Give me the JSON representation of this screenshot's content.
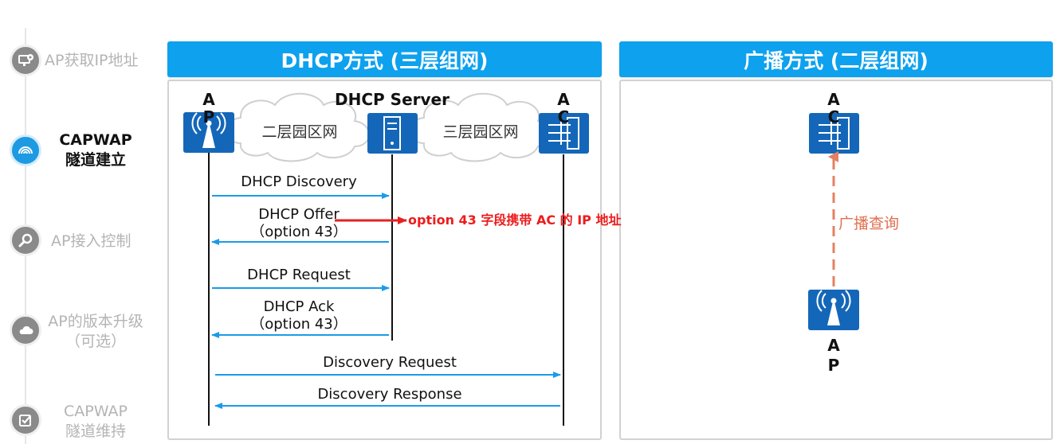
{
  "nav": {
    "steps": [
      {
        "label": "AP获取IP地址",
        "icon": "monitor-network-icon",
        "active": false
      },
      {
        "label_line1": "CAPWAP",
        "label_line2": "隧道建立",
        "icon": "rainbow-signal-icon",
        "active": true
      },
      {
        "label": "AP接入控制",
        "icon": "magnifier-icon",
        "active": false
      },
      {
        "label_line1": "AP的版本升级",
        "label_line2": "（可选）",
        "icon": "cloud-icon",
        "active": false
      },
      {
        "label_line1": "CAPWAP",
        "label_line2": "隧道维持",
        "icon": "checkbox-icon",
        "active": false
      }
    ]
  },
  "left_panel": {
    "title": "DHCP方式 (三层组网)",
    "nodes": {
      "ap": {
        "label1": "A",
        "label2": "P",
        "icon": "wireless-ap-icon"
      },
      "dhcp_server": {
        "label": "DHCP Server",
        "icon": "server-icon"
      },
      "ac": {
        "label1": "A",
        "label2": "C",
        "icon": "access-controller-icon"
      }
    },
    "clouds": [
      "二层园区网",
      "三层园区网"
    ],
    "messages": {
      "discovery": "DHCP Discovery",
      "offer": "DHCP Offer",
      "offer_option": "（option 43）",
      "request": "DHCP Request",
      "ack": "DHCP Ack",
      "ack_option": "（option 43）",
      "disc_request": "Discovery Request",
      "disc_response": "Discovery Response"
    },
    "note": "option 43 字段携带 AC 的 IP 地址"
  },
  "right_panel": {
    "title": "广播方式 (二层组网)",
    "ac": {
      "label1": "A",
      "label2": "C",
      "icon": "access-controller-icon"
    },
    "ap": {
      "label1": "A",
      "label2": "P",
      "icon": "wireless-ap-icon"
    },
    "broadcast_label": "广播查询"
  },
  "colors": {
    "header_blue": "#0da1ee",
    "arrow_blue": "#1a9be8",
    "device_blue": "#1467b8",
    "note_red": "#ee1c1c",
    "broadcast_orange": "#e58063"
  }
}
